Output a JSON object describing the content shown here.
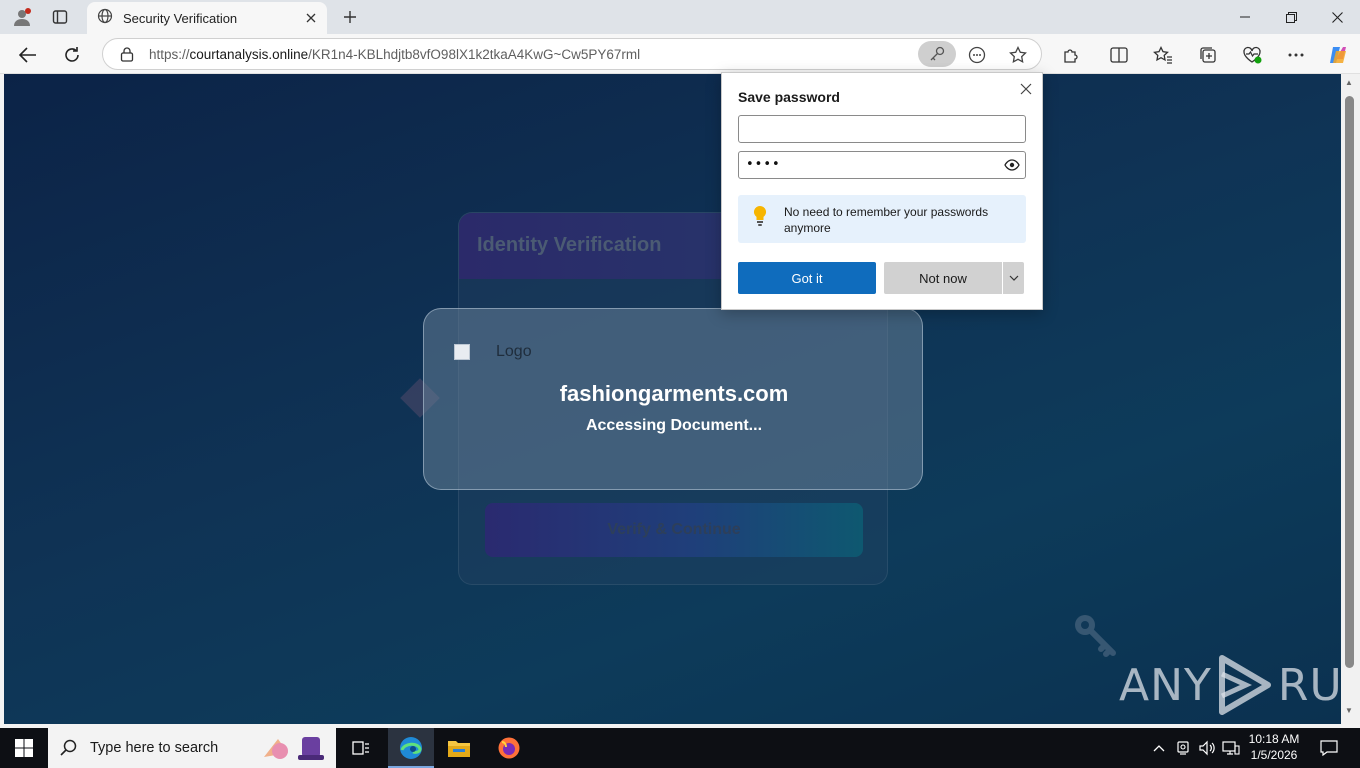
{
  "browser": {
    "tab_title": "Security Verification",
    "url_prefix": "https://",
    "url_host": "courtanalysis.online",
    "url_path": "/KR1n4-KBLhdjtb8vfO98lX1k2tkaA4KwG~Cw5PY67rml"
  },
  "page": {
    "card_title": "Identity Verification",
    "verify_button": "Verify & Continue",
    "logo_alt": "Logo",
    "site_name": "fashiongarments.com",
    "status": "Accessing Document..."
  },
  "watermark": {
    "left": "ANY",
    "right": "RUN"
  },
  "save_password": {
    "title": "Save password",
    "username_value": "",
    "password_mask": "••••",
    "tip": "No need to remember your passwords anymore",
    "got_it": "Got it",
    "not_now": "Not now"
  },
  "taskbar": {
    "search_placeholder": "Type here to search",
    "time": "10:18 AM",
    "date": "1/5/2026"
  },
  "colors": {
    "accent": "#0f6cbd",
    "page_bg": "#0f3355"
  }
}
